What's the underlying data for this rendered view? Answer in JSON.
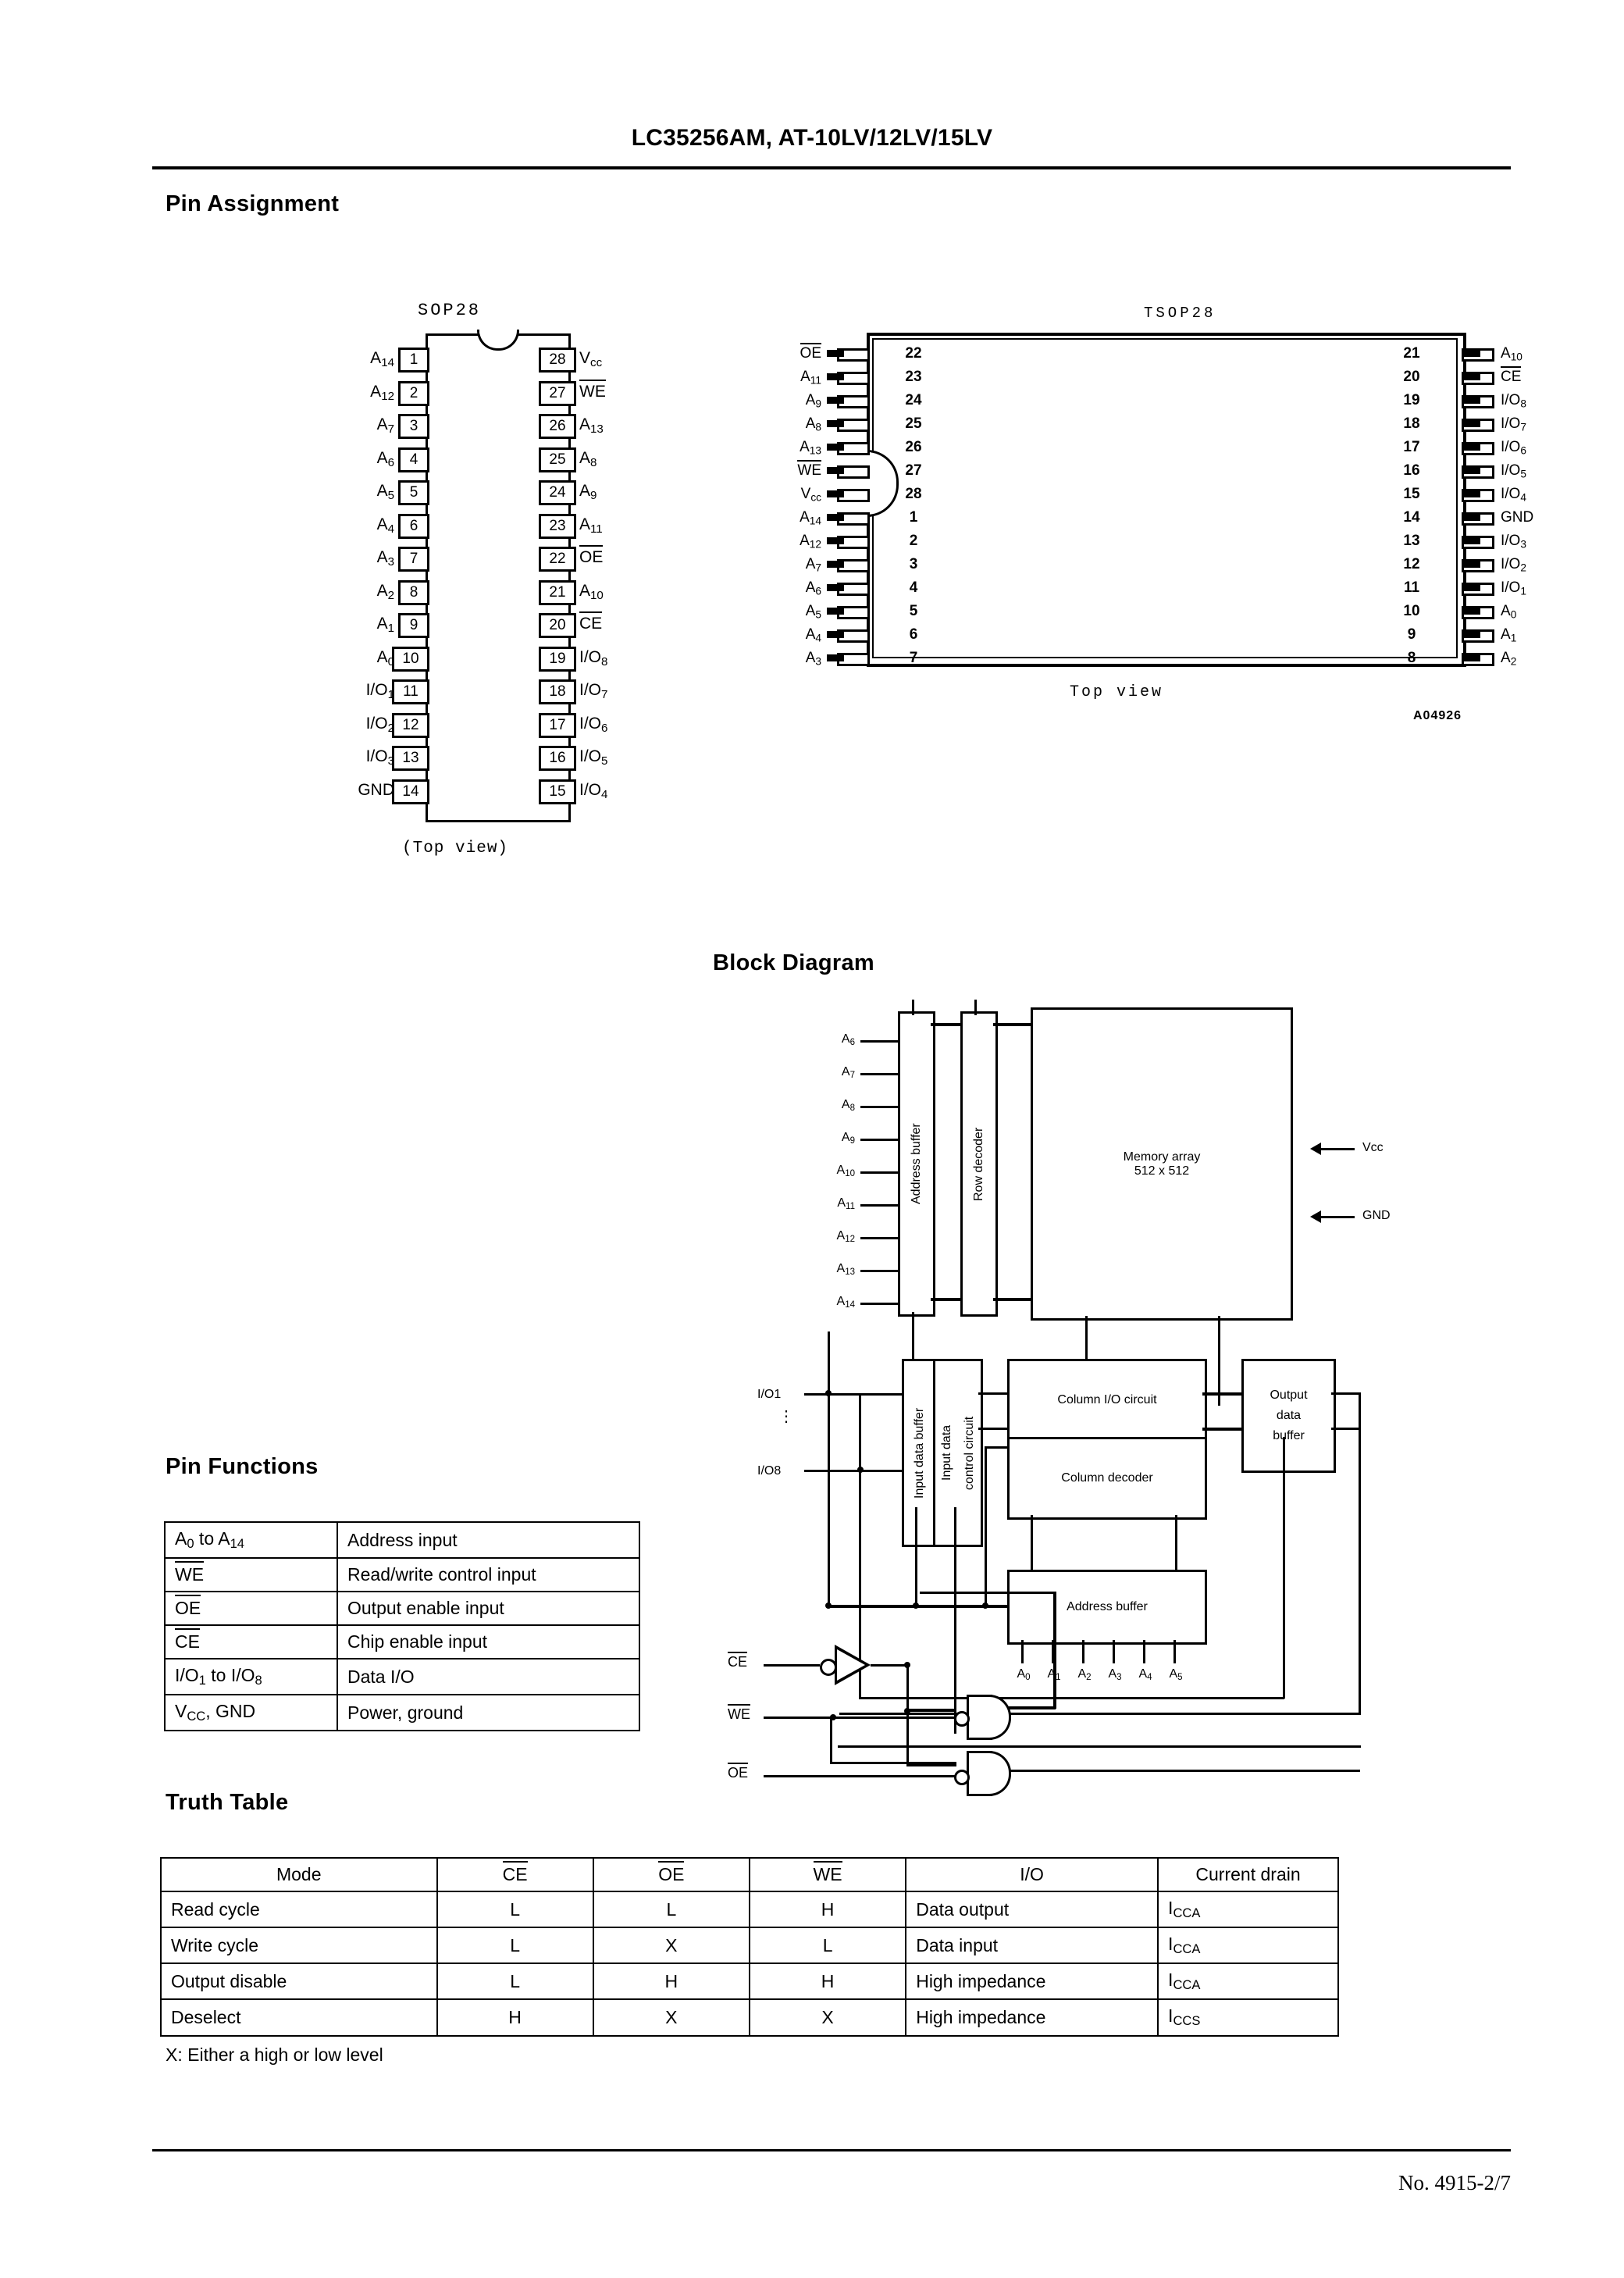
{
  "header": {
    "title": "LC35256AM, AT-10LV/12LV/15LV"
  },
  "footer": {
    "doc_no": "No. 4915-2/7"
  },
  "sections": {
    "pin_assignment": "Pin Assignment",
    "block_diagram": "Block Diagram",
    "pin_functions": "Pin Functions",
    "truth_table": "Truth Table"
  },
  "sop28": {
    "package": "SOP28",
    "view_label": "(Top view)",
    "left_pins": [
      {
        "num": "1",
        "label": "A14"
      },
      {
        "num": "2",
        "label": "A12"
      },
      {
        "num": "3",
        "label": "A7"
      },
      {
        "num": "4",
        "label": "A6"
      },
      {
        "num": "5",
        "label": "A5"
      },
      {
        "num": "6",
        "label": "A4"
      },
      {
        "num": "7",
        "label": "A3"
      },
      {
        "num": "8",
        "label": "A2"
      },
      {
        "num": "9",
        "label": "A1"
      },
      {
        "num": "10",
        "label": "A0"
      },
      {
        "num": "11",
        "label": "I/O1"
      },
      {
        "num": "12",
        "label": "I/O2"
      },
      {
        "num": "13",
        "label": "I/O3"
      },
      {
        "num": "14",
        "label": "GND"
      }
    ],
    "right_pins": [
      {
        "num": "28",
        "label": "Vcc"
      },
      {
        "num": "27",
        "label": "WE",
        "overbar": true
      },
      {
        "num": "26",
        "label": "A13"
      },
      {
        "num": "25",
        "label": "A8"
      },
      {
        "num": "24",
        "label": "A9"
      },
      {
        "num": "23",
        "label": "A11"
      },
      {
        "num": "22",
        "label": "OE",
        "overbar": true
      },
      {
        "num": "21",
        "label": "A10"
      },
      {
        "num": "20",
        "label": "CE",
        "overbar": true
      },
      {
        "num": "19",
        "label": "I/O8"
      },
      {
        "num": "18",
        "label": "I/O7"
      },
      {
        "num": "17",
        "label": "I/O6"
      },
      {
        "num": "16",
        "label": "I/O5"
      },
      {
        "num": "15",
        "label": "I/O4"
      }
    ]
  },
  "tsop28": {
    "package": "TSOP28",
    "view_label": "Top view",
    "drawing_code": "A04926",
    "left_pins": [
      {
        "num": "22",
        "label": "OE",
        "overbar": true
      },
      {
        "num": "23",
        "label": "A11"
      },
      {
        "num": "24",
        "label": "A9"
      },
      {
        "num": "25",
        "label": "A8"
      },
      {
        "num": "26",
        "label": "A13"
      },
      {
        "num": "27",
        "label": "WE",
        "overbar": true
      },
      {
        "num": "28",
        "label": "Vcc"
      },
      {
        "num": "1",
        "label": "A14"
      },
      {
        "num": "2",
        "label": "A12"
      },
      {
        "num": "3",
        "label": "A7"
      },
      {
        "num": "4",
        "label": "A6"
      },
      {
        "num": "5",
        "label": "A5"
      },
      {
        "num": "6",
        "label": "A4"
      },
      {
        "num": "7",
        "label": "A3"
      }
    ],
    "right_pins": [
      {
        "num": "21",
        "label": "A10"
      },
      {
        "num": "20",
        "label": "CE",
        "overbar": true
      },
      {
        "num": "19",
        "label": "I/O8"
      },
      {
        "num": "18",
        "label": "I/O7"
      },
      {
        "num": "17",
        "label": "I/O6"
      },
      {
        "num": "16",
        "label": "I/O5"
      },
      {
        "num": "15",
        "label": "I/O4"
      },
      {
        "num": "14",
        "label": "GND"
      },
      {
        "num": "13",
        "label": "I/O3"
      },
      {
        "num": "12",
        "label": "I/O2"
      },
      {
        "num": "11",
        "label": "I/O1"
      },
      {
        "num": "10",
        "label": "A0"
      },
      {
        "num": "9",
        "label": "A1"
      },
      {
        "num": "8",
        "label": "A2"
      }
    ]
  },
  "block_diagram": {
    "address_inputs": [
      "A6",
      "A7",
      "A8",
      "A9",
      "A10",
      "A11",
      "A12",
      "A13",
      "A14"
    ],
    "column_address_inputs": [
      "A0",
      "A1",
      "A2",
      "A3",
      "A4",
      "A5"
    ],
    "io_top": "I/O1",
    "io_bottom": "I/O8",
    "blocks": {
      "address_buffer": "Address buffer",
      "row_decoder": "Row decoder",
      "memory_array_l1": "Memory array",
      "memory_array_l2": "512 x 512",
      "input_data_buffer": "Input data buffer",
      "input_data_control_l1": "Input data",
      "input_data_control_l2": "control circuit",
      "column_io_circuit": "Column I/O circuit",
      "column_decoder": "Column decoder",
      "output_data_l1": "Output",
      "output_data_l2": "data",
      "output_data_l3": "buffer",
      "address_buffer_2": "Address buffer"
    },
    "power": {
      "vcc": "Vcc",
      "gnd": "GND"
    },
    "control_inputs": [
      {
        "label": "CE",
        "overbar": true
      },
      {
        "label": "WE",
        "overbar": true
      },
      {
        "label": "OE",
        "overbar": true
      }
    ]
  },
  "pin_functions": {
    "rows": [
      {
        "pin": "A0 to A14",
        "pin_html": "A<sub>0</sub> to A<sub>14</sub>",
        "function": "Address input"
      },
      {
        "pin": "WE",
        "pin_html": "<span class=\"ovl\">WE</span>",
        "function": "Read/write control input"
      },
      {
        "pin": "OE",
        "pin_html": "<span class=\"ovl\">OE</span>",
        "function": "Output enable input"
      },
      {
        "pin": "CE",
        "pin_html": "<span class=\"ovl\">CE</span>",
        "function": "Chip enable input"
      },
      {
        "pin": "I/O1 to I/O8",
        "pin_html": "I/O<sub>1</sub> to I/O<sub>8</sub>",
        "function": "Data I/O"
      },
      {
        "pin": "Vcc, GND",
        "pin_html": "V<sub>CC</sub>, GND",
        "function": "Power, ground"
      }
    ]
  },
  "truth_table": {
    "headers": [
      "Mode",
      "CE",
      "OE",
      "WE",
      "I/O",
      "Current drain"
    ],
    "headers_html": [
      "Mode",
      "<span class=\"ovl\">CE</span>",
      "<span class=\"ovl\">OE</span>",
      "<span class=\"ovl\">WE</span>",
      "I/O",
      "Current drain"
    ],
    "rows": [
      {
        "mode": "Read cycle",
        "ce": "L",
        "oe": "L",
        "we": "H",
        "io": "Data output",
        "current": "ICCA",
        "current_html": "I<sub>CCA</sub>"
      },
      {
        "mode": "Write cycle",
        "ce": "L",
        "oe": "X",
        "we": "L",
        "io": "Data input",
        "current": "ICCA",
        "current_html": "I<sub>CCA</sub>"
      },
      {
        "mode": "Output disable",
        "ce": "L",
        "oe": "H",
        "we": "H",
        "io": "High impedance",
        "current": "ICCA",
        "current_html": "I<sub>CCA</sub>"
      },
      {
        "mode": "Deselect",
        "ce": "H",
        "oe": "X",
        "we": "X",
        "io": "High impedance",
        "current": "ICCS",
        "current_html": "I<sub>CCS</sub>"
      }
    ],
    "note": "X: Either a high or low level"
  }
}
